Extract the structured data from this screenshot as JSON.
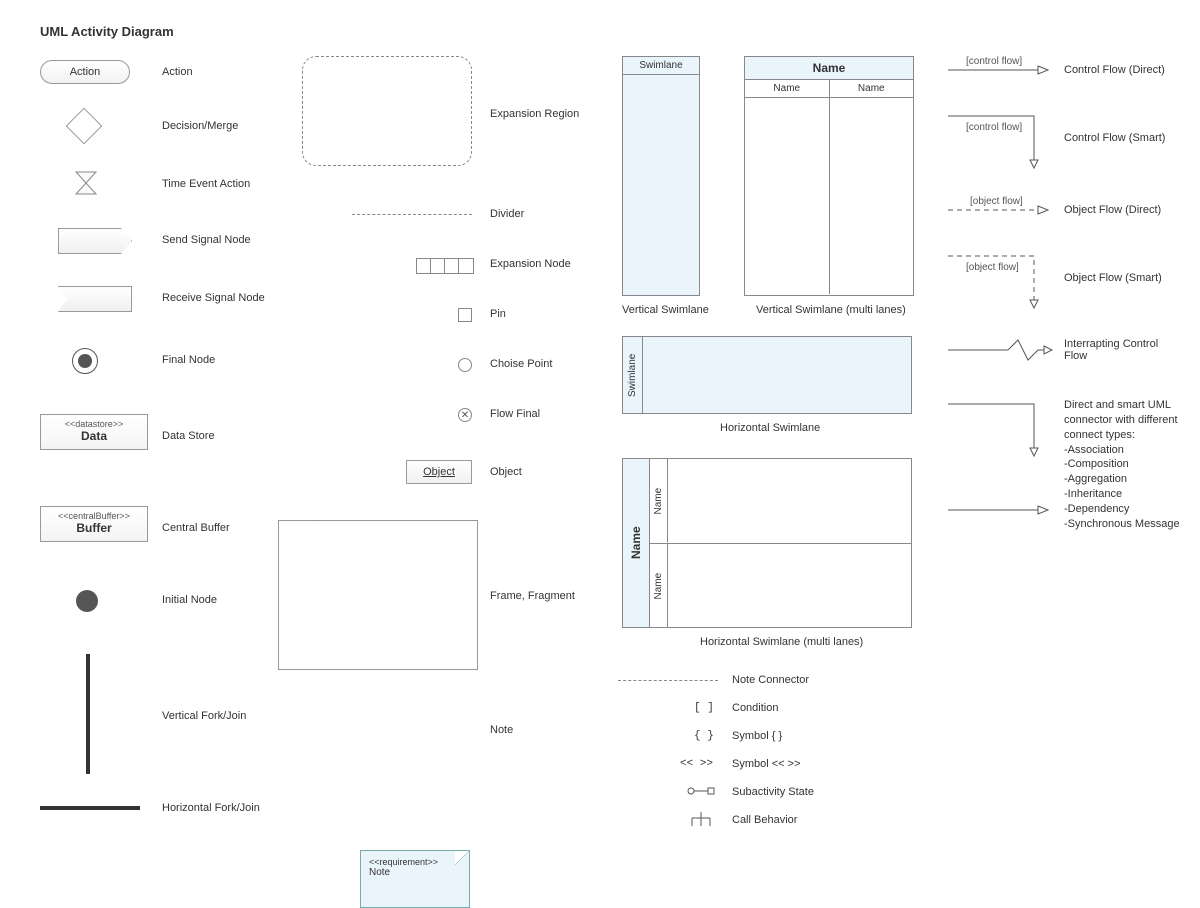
{
  "title": "UML Activity Diagram",
  "col1": {
    "action": {
      "text": "Action",
      "label": "Action"
    },
    "decision": {
      "label": "Decision/Merge"
    },
    "time_event": {
      "label": "Time Event Action"
    },
    "send_signal": {
      "label": "Send Signal Node"
    },
    "receive_signal": {
      "label": "Receive Signal Node"
    },
    "final_node": {
      "label": "Final Node"
    },
    "datastore": {
      "stereo": "<<datastore>>",
      "name": "Data",
      "label": "Data Store"
    },
    "central_buffer": {
      "stereo": "<<centralBuffer>>",
      "name": "Buffer",
      "label": "Central Buffer"
    },
    "initial_node": {
      "label": "Initial Node"
    },
    "vertical_fork": {
      "label": "Vertical Fork/Join"
    },
    "horizontal_fork": {
      "label": "Horizontal Fork/Join"
    }
  },
  "col2": {
    "expansion_region": {
      "label": "Expansion Region"
    },
    "divider": {
      "label": "Divider"
    },
    "expansion_node": {
      "label": "Expansion Node"
    },
    "pin": {
      "label": "Pin"
    },
    "choice_point": {
      "label": "Choise Point"
    },
    "flow_final": {
      "label": "Flow Final"
    },
    "object": {
      "text": "Object",
      "label": "Object"
    },
    "frame": {
      "label": "Frame, Fragment"
    },
    "note": {
      "stereo": "<<requirement>>",
      "text": "Note",
      "label": "Note"
    }
  },
  "swimlanes": {
    "v_single": {
      "header": "Swimlane",
      "label": "Vertical Swimlane"
    },
    "v_multi": {
      "top": "Name",
      "col1": "Name",
      "col2": "Name",
      "label": "Vertical Swimlane (multi lanes)"
    },
    "h_single": {
      "header": "Swimlane",
      "label": "Horizontal Swimlane"
    },
    "h_multi": {
      "side": "Name",
      "row1": "Name",
      "row2": "Name",
      "label": "Horizontal Swimlane (multi lanes)"
    }
  },
  "connectors": {
    "control_direct": {
      "tag": "[control flow]",
      "label": "Control Flow (Direct)"
    },
    "control_smart": {
      "tag": "[control flow]",
      "label": "Control Flow (Smart)"
    },
    "object_direct": {
      "tag": "[object flow]",
      "label": "Object Flow (Direct)"
    },
    "object_smart": {
      "tag": "[object flow]",
      "label": "Object Flow (Smart)"
    },
    "interrupt": {
      "label": "Interrapting Control Flow"
    },
    "generic": {
      "label": "Direct and smart UML connector with different connect types:",
      "types": [
        "-Association",
        "-Composition",
        "-Aggregation",
        "-Inheritance",
        "-Dependency",
        "-Synchronous Message"
      ]
    }
  },
  "symbols": {
    "note_connector": "Note Connector",
    "condition_glyph": "[  ]",
    "condition": "Condition",
    "symbol_braces_glyph": "{  }",
    "symbol_braces": "Symbol { }",
    "symbol_angles_glyph": "<<  >>",
    "symbol_angles": "Symbol << >>",
    "subactivity": "Subactivity State",
    "call_behavior": "Call Behavior"
  }
}
